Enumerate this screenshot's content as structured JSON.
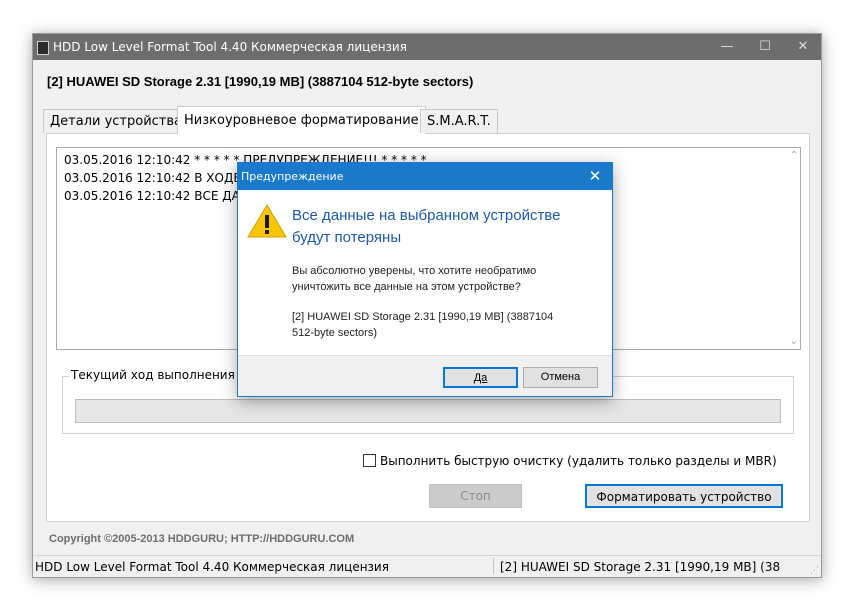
{
  "window": {
    "title": "HDD Low Level Format Tool 4.40   Коммерческая лицензия",
    "minimize_glyph": "—",
    "maximize_glyph": "☐",
    "close_glyph": "✕"
  },
  "device_line": "[2]  HUAWEI SD Storage   2.31   [1990,19 MB]   (3887104 512-byte sectors)",
  "tabs": [
    {
      "label": "Детали устройства"
    },
    {
      "label": "Низкоуровневое форматирование"
    },
    {
      "label": "S.M.A.R.T."
    }
  ],
  "log": [
    "03.05.2016 12:10:42   * * * * * ПРЕДУПРЕЖДЕНИЕ!!! * * * * *",
    "03.05.2016 12:10:42   В ХОДЕ",
    "03.05.2016 12:10:42   ВСЕ ДА"
  ],
  "progress": {
    "label": "Текущий ход выполнения",
    "value": 0
  },
  "quick_wipe_label": "Выполнить быструю очистку (удалить только разделы и MBR)",
  "stop_button": "Стоп",
  "format_button": "Форматировать устройство",
  "copyright": "Copyright ©2005-2013 HDDGURU;  HTTP://HDDGURU.COM",
  "statusbar": {
    "left": "HDD Low Level Format Tool 4.40   Коммерческая лицензия",
    "right": "[2]  HUAWEI SD Storage   2.31   [1990,19 MB]   (38"
  },
  "dialog": {
    "title": "Предупреждение",
    "close_glyph": "✕",
    "main_line1": "Все данные на выбранном устройстве",
    "main_line2": "будут потеряны",
    "confirm_line1": "Вы абсолютно уверены, что хотите необратимо",
    "confirm_line2": "уничтожить все данные на этом устройстве?",
    "device_line1": "[2]  HUAWEI SD Storage    2.31    [1990,19 MB]    (3887104",
    "device_line2": "512-byte sectors)",
    "yes_button": "Да",
    "cancel_button": "Отмена"
  },
  "colors": {
    "accent": "#0078d7",
    "dialog_titlebar": "#1979ca",
    "main_titlebar": "#6d6d6d",
    "warning_yellow": "#f7c600",
    "heading_blue": "#1e5aa8"
  }
}
